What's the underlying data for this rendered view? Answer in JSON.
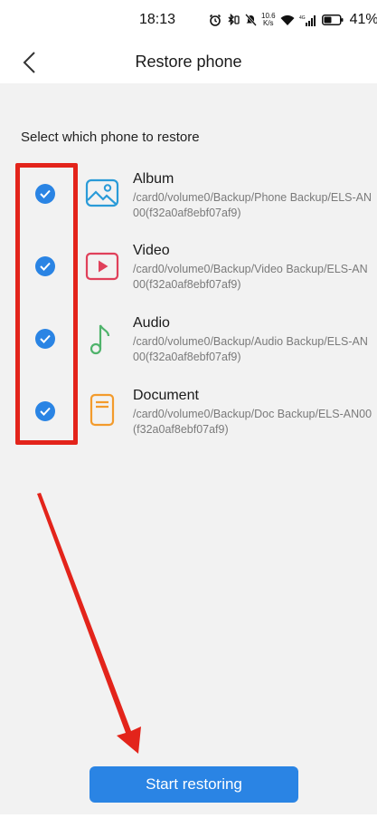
{
  "status_bar": {
    "time": "18:13",
    "net_speed_value": "10.6",
    "net_speed_unit": "K/s",
    "signal_label": "4G",
    "battery": "41%"
  },
  "app_bar": {
    "title": "Restore phone",
    "back_icon": "chevron-left-icon"
  },
  "section_label": "Select which phone to restore",
  "items": [
    {
      "title": "Album",
      "path": "/card0/volume0/Backup/Phone Backup/ELS-AN00(f32a0af8ebf07af9)",
      "checked": true,
      "icon": "album-icon",
      "color": "#2a9bd8"
    },
    {
      "title": "Video",
      "path": "/card0/volume0/Backup/Video Backup/ELS-AN00(f32a0af8ebf07af9)",
      "checked": true,
      "icon": "video-icon",
      "color": "#e0405a"
    },
    {
      "title": "Audio",
      "path": "/card0/volume0/Backup/Audio Backup/ELS-AN00(f32a0af8ebf07af9)",
      "checked": true,
      "icon": "music-note-icon",
      "color": "#4fb36b"
    },
    {
      "title": "Document",
      "path": "/card0/volume0/Backup/Doc Backup/ELS-AN00(f32a0af8ebf07af9)",
      "checked": true,
      "icon": "document-icon",
      "color": "#f39b2c"
    }
  ],
  "restore_button": {
    "label": "Start restoring"
  },
  "colors": {
    "accent": "#2a84e4",
    "annotation": "#e3241b",
    "background": "#f2f2f2"
  }
}
